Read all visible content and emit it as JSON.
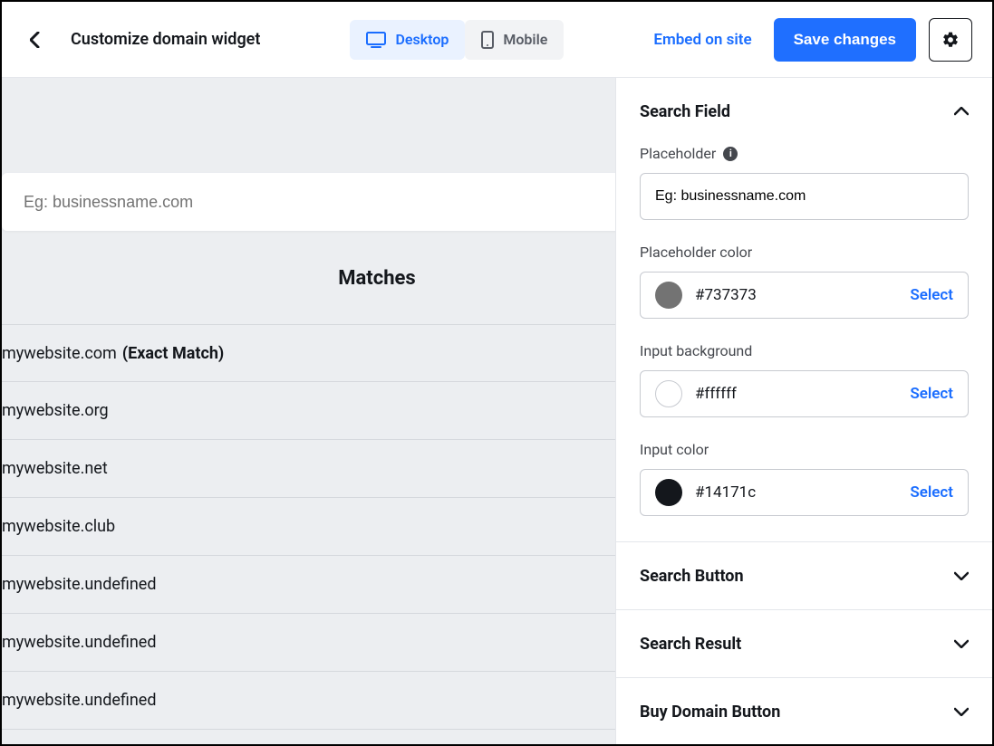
{
  "header": {
    "title": "Customize domain widget",
    "desktop_label": "Desktop",
    "mobile_label": "Mobile",
    "embed_label": "Embed on site",
    "save_label": "Save changes"
  },
  "preview": {
    "search_placeholder": "Eg: businessname.com",
    "matches_title": "Matches",
    "results": [
      {
        "domain": "mywebsite.com",
        "extra": "(Exact Match)"
      },
      {
        "domain": "mywebsite.org",
        "extra": ""
      },
      {
        "domain": "mywebsite.net",
        "extra": ""
      },
      {
        "domain": "mywebsite.club",
        "extra": ""
      },
      {
        "domain": "mywebsite.undefined",
        "extra": ""
      },
      {
        "domain": "mywebsite.undefined",
        "extra": ""
      },
      {
        "domain": "mywebsite.undefined",
        "extra": ""
      }
    ]
  },
  "panel": {
    "search_field": {
      "title": "Search Field",
      "placeholder_label": "Placeholder",
      "placeholder_value": "Eg: businessname.com",
      "placeholder_color_label": "Placeholder color",
      "placeholder_color_value": "#737373",
      "input_bg_label": "Input background",
      "input_bg_value": "#ffffff",
      "input_color_label": "Input color",
      "input_color_value": "#14171c",
      "select_label": "Select"
    },
    "search_button_title": "Search Button",
    "search_result_title": "Search Result",
    "buy_button_title": "Buy Domain Button"
  }
}
